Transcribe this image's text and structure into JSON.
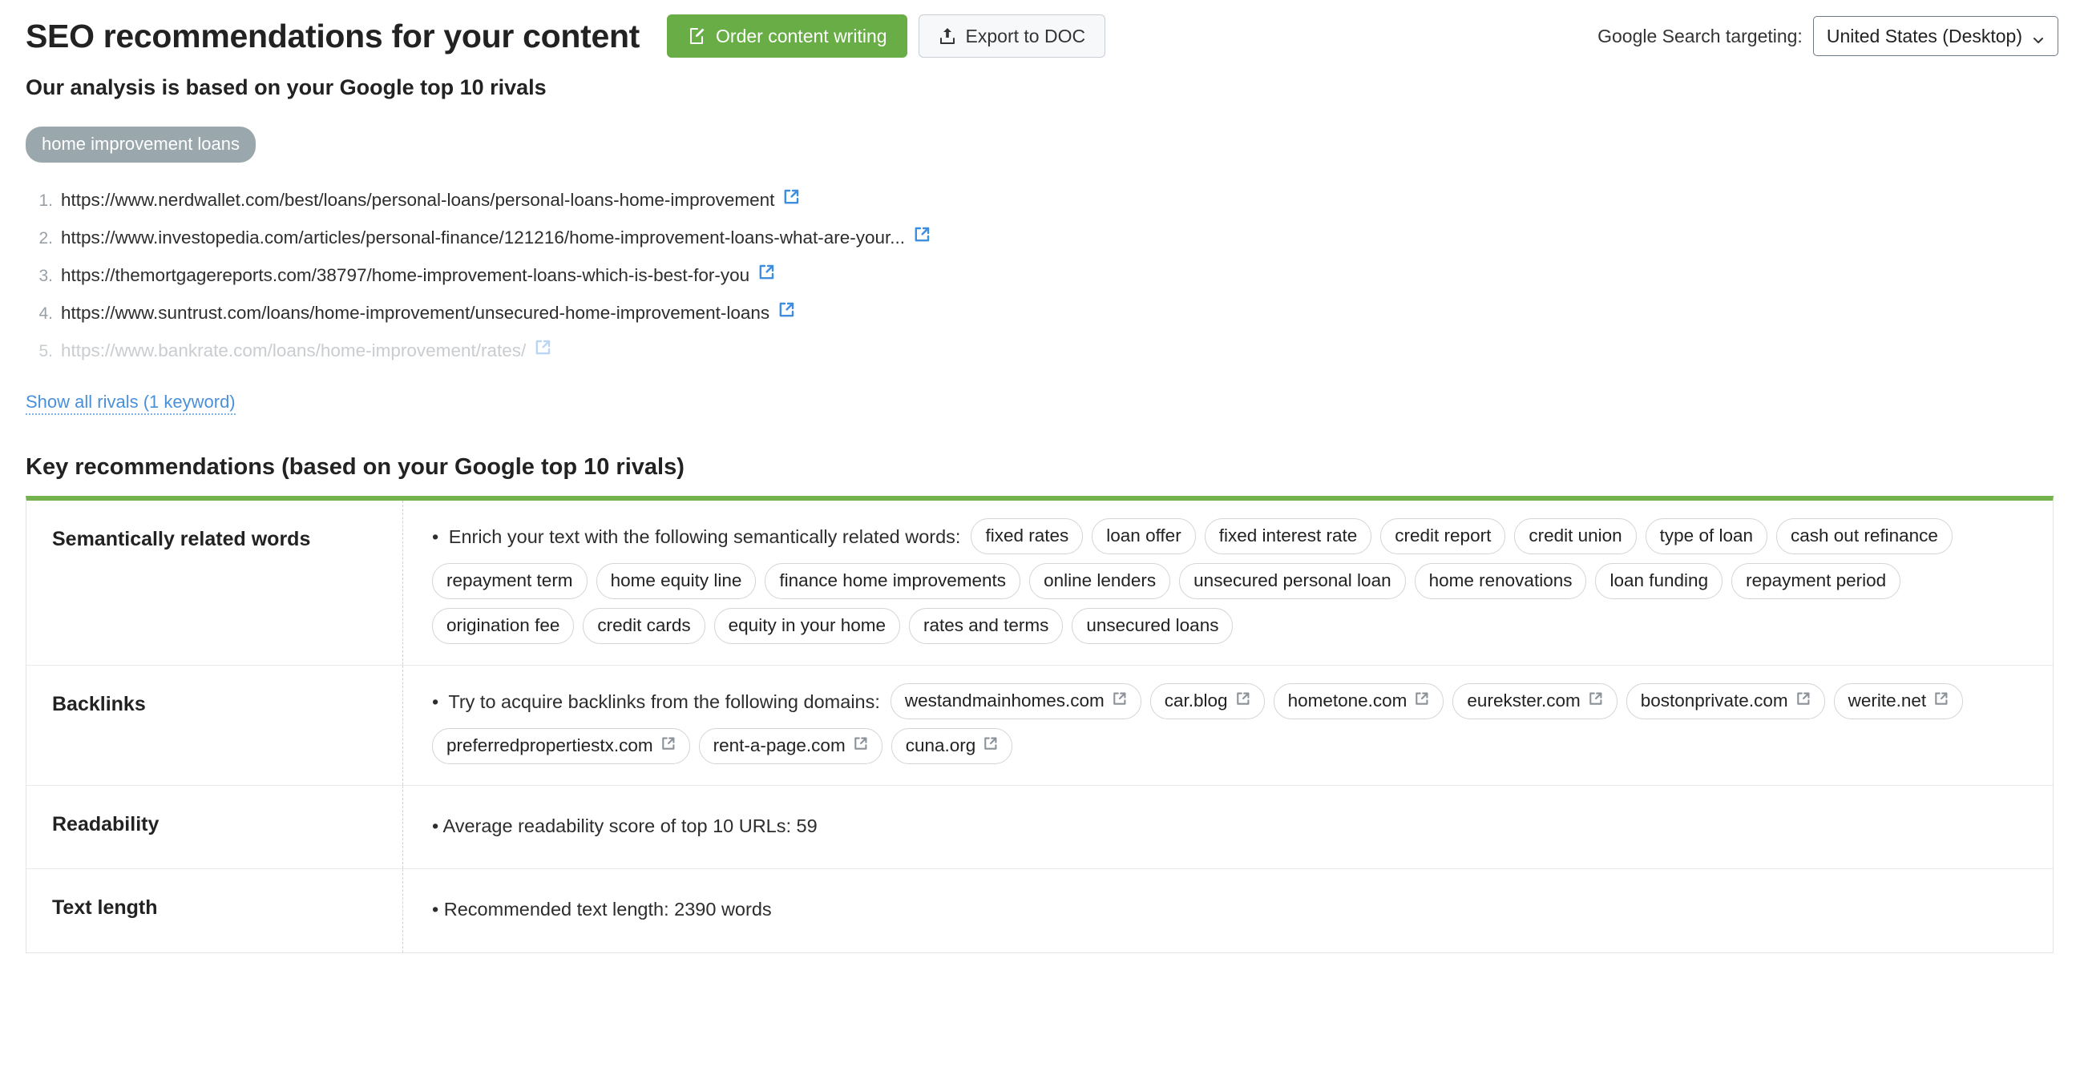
{
  "header": {
    "title": "SEO recommendations for your content",
    "order_button": "Order content writing",
    "order_icon": "edit-document-icon",
    "export_button": "Export to DOC",
    "export_icon": "upload-icon",
    "targeting_label": "Google Search targeting:",
    "targeting_value": "United States (Desktop)",
    "targeting_chevron": "chevron-down-icon",
    "primary_color": "#68ad45",
    "accent_color": "#74b24e"
  },
  "analysis": {
    "subtitle": "Our analysis is based on your Google top 10 rivals",
    "keyword": "home improvement loans",
    "rivals": [
      {
        "index": "1.",
        "url": "https://www.nerdwallet.com/best/loans/personal-loans/personal-loans-home-improvement",
        "dimmed": false
      },
      {
        "index": "2.",
        "url": "https://www.investopedia.com/articles/personal-finance/121216/home-improvement-loans-what-are-your...",
        "dimmed": false
      },
      {
        "index": "3.",
        "url": "https://themortgagereports.com/38797/home-improvement-loans-which-is-best-for-you",
        "dimmed": false
      },
      {
        "index": "4.",
        "url": "https://www.suntrust.com/loans/home-improvement/unsecured-home-improvement-loans",
        "dimmed": false
      },
      {
        "index": "5.",
        "url": "https://www.bankrate.com/loans/home-improvement/rates/",
        "dimmed": true
      }
    ],
    "show_all_link": "Show all rivals (1 keyword)"
  },
  "recommendations": {
    "section_title": "Key recommendations (based on your Google top 10 rivals)",
    "rows": [
      {
        "label": "Semantically related words",
        "lead": "Enrich your text with the following semantically related words:",
        "tags": [
          "fixed rates",
          "loan offer",
          "fixed interest rate",
          "credit report",
          "credit union",
          "type of loan",
          "cash out refinance",
          "repayment term",
          "home equity line",
          "finance home improvements",
          "online lenders",
          "unsecured personal loan",
          "home renovations",
          "loan funding",
          "repayment period",
          "origination fee",
          "credit cards",
          "equity in your home",
          "rates and terms",
          "unsecured loans"
        ]
      },
      {
        "label": "Backlinks",
        "lead": "Try to acquire backlinks from the following domains:",
        "tags": [
          "westandmainhomes.com",
          "car.blog",
          "hometone.com",
          "eurekster.com",
          "bostonprivate.com",
          "werite.net",
          "preferredpropertiestx.com",
          "rent-a-page.com",
          "cuna.org"
        ],
        "tags_are_links": true
      },
      {
        "label": "Readability",
        "text": "Average readability score of top 10 URLs:  59"
      },
      {
        "label": "Text length",
        "text": "Recommended text length:  2390 words"
      }
    ]
  }
}
